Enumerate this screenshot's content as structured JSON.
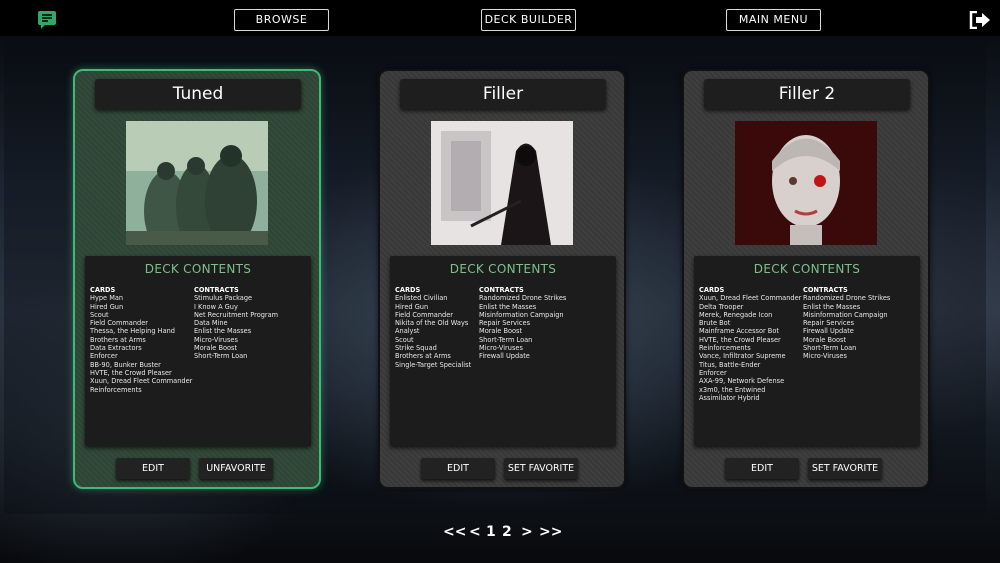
{
  "nav": {
    "browse": "BROWSE",
    "deck_builder": "DECK BUILDER",
    "main_menu": "MAIN MENU"
  },
  "decks": [
    {
      "title": "Tuned",
      "favorite": true,
      "contents_title": "DECK CONTENTS",
      "cards_header": "CARDS",
      "contracts_header": "CONTRACTS",
      "cards": [
        "Hype Man",
        "Hired Gun",
        "Scout",
        "Field Commander",
        "Thessa, the Helping Hand",
        "Brothers at Arms",
        "Data Extractors",
        "Enforcer",
        "BB-90, Bunker Buster",
        "HVTE, the Crowd Pleaser",
        "Xuun, Dread Fleet Commander",
        "Reinforcements"
      ],
      "contracts": [
        "Stimulus Package",
        "I Know A Guy",
        "Net Recruitment Program",
        "Data Mine",
        "Enlist the Masses",
        "Micro-Viruses",
        "Morale Boost",
        "Short-Term Loan"
      ],
      "edit_label": "EDIT",
      "fav_label": "UNFAVORITE"
    },
    {
      "title": "Filler",
      "favorite": false,
      "contents_title": "DECK CONTENTS",
      "cards_header": "CARDS",
      "contracts_header": "CONTRACTS",
      "cards": [
        "Enlisted Civilian",
        "Hired Gun",
        "Field Commander",
        "Nikita of the Old Ways",
        "Analyst",
        "Scout",
        "Strike Squad",
        "Brothers at Arms",
        "Single-Target Specialist"
      ],
      "contracts": [
        "Randomized Drone Strikes",
        "Enlist the Masses",
        "Misinformation Campaign",
        "Repair Services",
        "Morale Boost",
        "Short-Term Loan",
        "Micro-Viruses",
        "Firewall Update"
      ],
      "edit_label": "EDIT",
      "fav_label": "SET FAVORITE"
    },
    {
      "title": "Filler 2",
      "favorite": false,
      "contents_title": "DECK CONTENTS",
      "cards_header": "CARDS",
      "contracts_header": "CONTRACTS",
      "cards": [
        "Xuun, Dread Fleet Commander",
        "Delta Trooper",
        "Merek, Renegade Icon",
        "Brute Bot",
        "Mainframe Accessor Bot",
        "HVTE, the Crowd Pleaser",
        "Reinforcements",
        "Vance, Infiltrator Supreme",
        "Titus, Battle-Ender",
        "Enforcer",
        "AXA-99, Network Defense",
        "x3m0, the Entwined",
        "Assimilator Hybrid"
      ],
      "contracts": [
        "Randomized Drone Strikes",
        "Enlist the Masses",
        "Misinformation Campaign",
        "Repair Services",
        "Firewall Update",
        "Morale Boost",
        "Short-Term Loan",
        "Micro-Viruses"
      ],
      "edit_label": "EDIT",
      "fav_label": "SET FAVORITE"
    }
  ],
  "pagination": {
    "first": "<<",
    "prev": "<",
    "page1": "1",
    "page2": "2",
    "next": ">",
    "last": ">>"
  },
  "icons": {
    "chat": "chat-bubble-icon",
    "exit": "exit-icon"
  },
  "colors": {
    "accent_green": "#3fb878",
    "contents_title": "#7fbf8a"
  }
}
